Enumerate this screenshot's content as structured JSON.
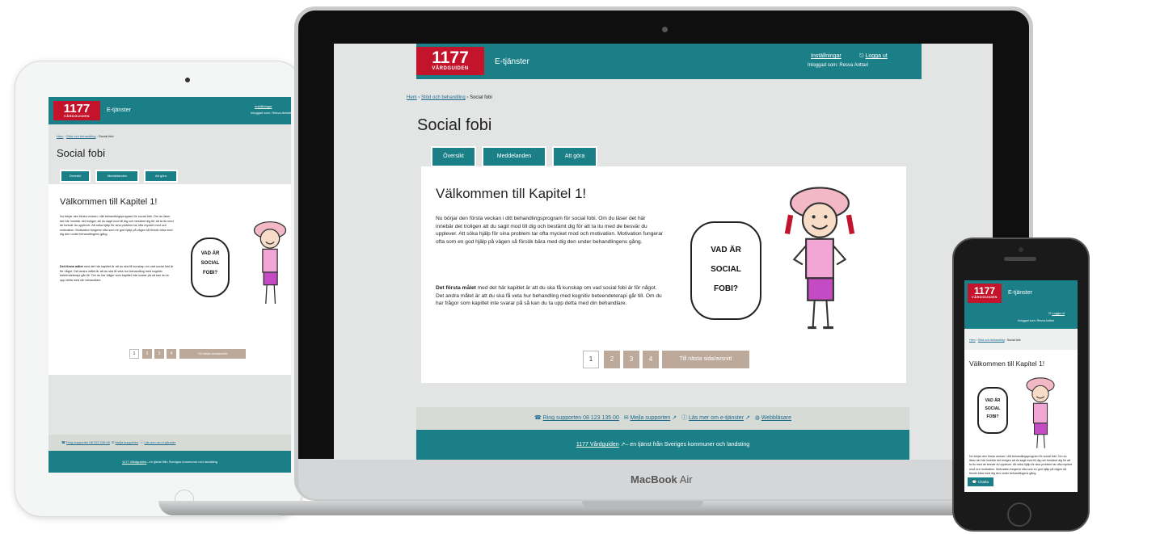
{
  "site": {
    "logo_number": "1177",
    "logo_sub": "VÅRDGUIDEN",
    "service": "E-tjänster",
    "header_links": {
      "settings": "Inställningar",
      "logout": "Logga ut"
    },
    "logged_in_as": "Inloggad som: Resva Anttari",
    "breadcrumb": {
      "home": "Hem",
      "parent": "Stöd och behandling",
      "current": "Social fobi"
    },
    "page_title": "Social fobi",
    "tabs": [
      "Översikt",
      "Meddelanden",
      "Att göra"
    ],
    "chapter_title": "Välkommen till Kapitel 1!",
    "paragraph1": "Nu börjar den första veckan i ditt behandlingsprogram för social fobi. Om du läser det här innebär det troligen att du sagit mod till dig och bestämt dig för att ta itu med de besvär du upplever. Att söka hjälp för sina problem tar ofta mycket mod och motivation. Motivation fungerar ofta som en god hjälp på vägen så försök bära med dig den under behandlingens gång.",
    "paragraph2_bold": "Det första målet",
    "paragraph2": " med det här kapitlet är att du ska få kunskap om vad social fobi är för något. Det andra målet är att du ska få veta hur behandling med kognitiv beteendeterapi går till. Om du har frågor som kapitlet inte svarar på så kan du ta upp detta med din behandlare.",
    "speech_bubble": [
      "VAD ÄR",
      "SOCIAL",
      "FOBI?"
    ],
    "pagination": [
      "1",
      "2",
      "3",
      "4"
    ],
    "next_button": "Till nästa sida/avsnitt",
    "support_links": {
      "phone": "Ring supporten 08 123 135 00",
      "mail": "Mejla supporten",
      "read": "Läs mer om e-tjänster",
      "accessibility": "Webbläsare"
    },
    "footer_brand": "1177 Vårdguiden",
    "footer_text": "– en tjänst från Sveriges kommuner och landsting"
  },
  "phone_extra": {
    "chat": "Chatta"
  },
  "laptop_label": {
    "brand": "MacBook",
    "model": "Air"
  },
  "colors": {
    "teal": "#1b7f88",
    "brand_red": "#c4142c",
    "tan": "#bda99a"
  }
}
